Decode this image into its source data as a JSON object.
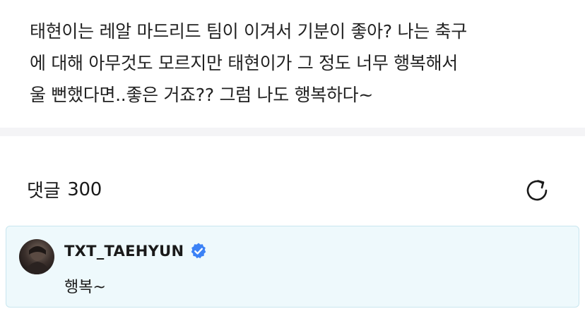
{
  "post": {
    "lines": [
      "태현이는 레알 마드리드 팀이 이겨서 기분이 좋아? 나는 축구",
      "에 대해 아무것도 모르지만 태현이가 그 정도 너무 행복해서",
      "울 뻔했다면..좋은 거죠?? 그럼 나도 행복하다~"
    ]
  },
  "comments": {
    "label": "댓글",
    "count": "300",
    "refresh_icon": "refresh-icon"
  },
  "comment": {
    "author": "TXT_TAEHYUN",
    "verified_icon": "verified-badge-icon",
    "text": "행복~",
    "highlight_color": "#eef9fc",
    "badge_color": "#3b82f6"
  }
}
